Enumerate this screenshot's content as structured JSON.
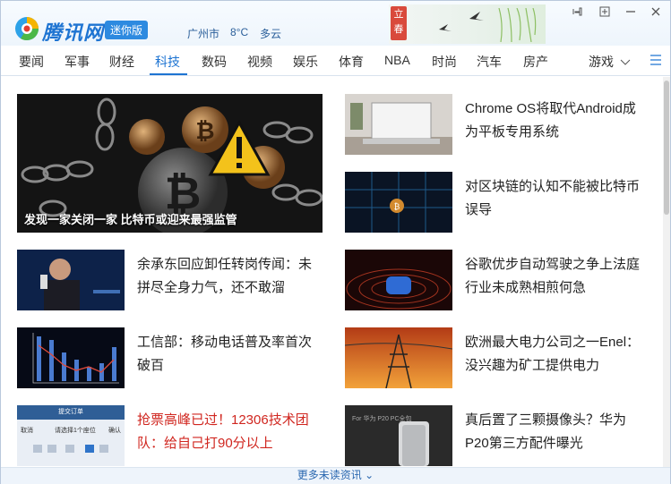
{
  "header": {
    "brand": "腾讯网",
    "mini_label": "迷你版",
    "city": "广州市",
    "temperature": "8°C",
    "condition": "多云",
    "banner_text": "立春"
  },
  "nav": {
    "items": [
      "要闻",
      "军事",
      "财经",
      "科技",
      "数码",
      "视频",
      "娱乐",
      "体育",
      "NBA",
      "时尚",
      "汽车",
      "房产"
    ],
    "active": "科技",
    "more_label": "游戏"
  },
  "hero": {
    "caption": "发现一家关闭一家 比特币或迎来最强监管"
  },
  "articles": [
    {
      "title": "Chrome OS将取代Android成为平板专用系统",
      "color": "#222222"
    },
    {
      "title": "对区块链的认知不能被比特币误导",
      "color": "#222222"
    },
    {
      "title": "余承东回应卸任转岗传闻：未拼尽全身力气，还不敢溜",
      "color": "#222222"
    },
    {
      "title": "谷歌优步自动驾驶之争上法庭 行业未成熟相煎何急",
      "color": "#222222"
    },
    {
      "title": "工信部：移动电话普及率首次破百",
      "color": "#222222"
    },
    {
      "title": "欧洲最大电力公司之一Enel：没兴趣为矿工提供电力",
      "color": "#222222"
    },
    {
      "title": "抢票高峰已过！12306技术团队：给自己打90分以上",
      "color": "#d0261f"
    },
    {
      "title": "真后置了三颗摄像头？华为P20第三方配件曝光",
      "color": "#222222"
    }
  ],
  "thumb_texts": {
    "ticket_top": "提交订单",
    "ticket_cancel": "取消",
    "ticket_select": "请选择1个座位",
    "ticket_ok": "确认",
    "phone_case": "For 华为 P20 PC全包"
  },
  "footer": {
    "more": "更多未读资讯 ⌄"
  },
  "icons": [
    "pin-icon",
    "restore-icon",
    "minimize-icon",
    "close-icon",
    "menu-icon",
    "chevron-down-icon"
  ],
  "colors": {
    "accent": "#1e74d2",
    "highlight_red": "#d0261f"
  }
}
